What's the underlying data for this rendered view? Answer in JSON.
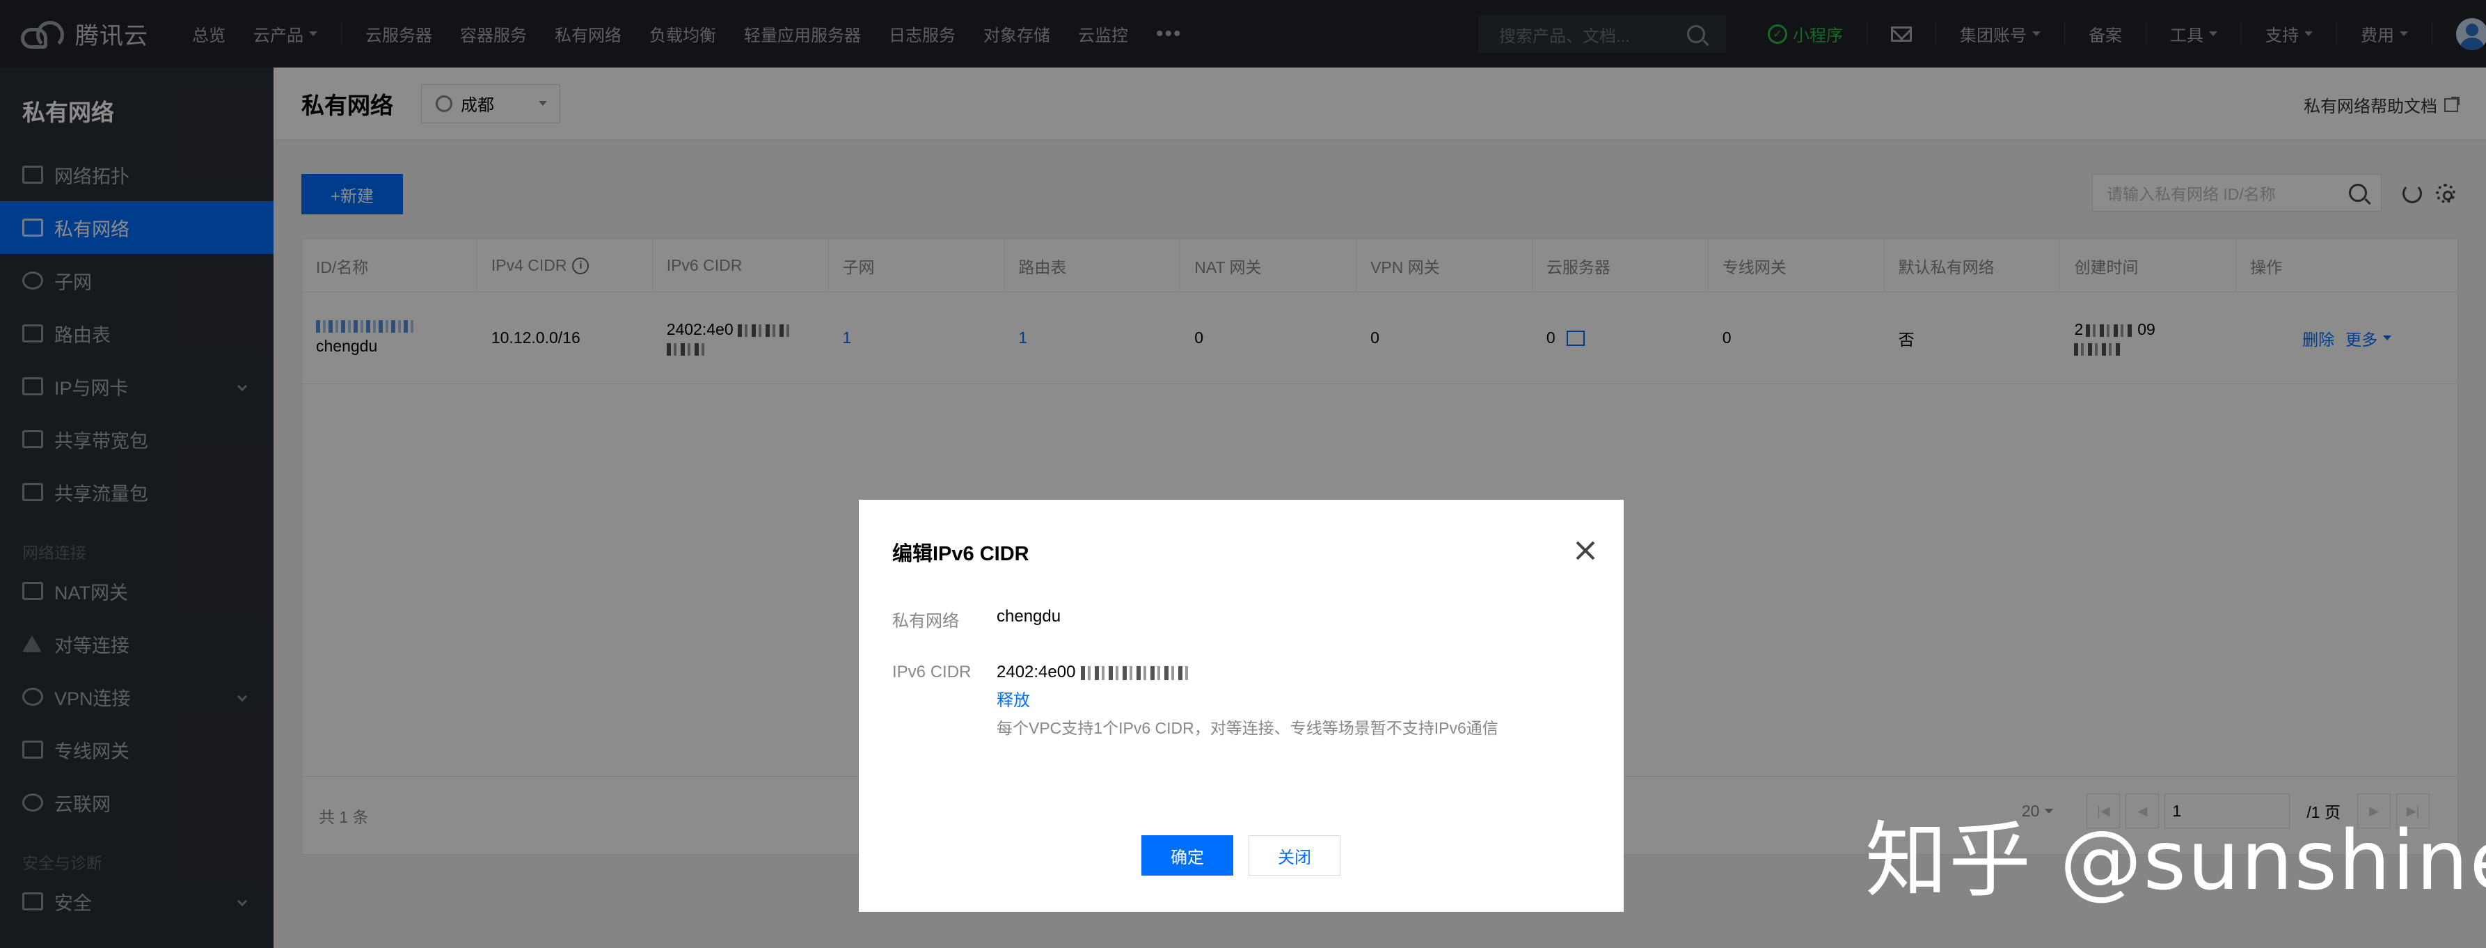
{
  "topnav": {
    "brand": "腾讯云",
    "items": [
      "总览",
      "云产品",
      "云服务器",
      "容器服务",
      "私有网络",
      "负载均衡",
      "轻量应用服务器",
      "日志服务",
      "对象存储",
      "云监控"
    ],
    "search_placeholder": "搜索产品、文档...",
    "mini_program": "小程序",
    "right_items": [
      "集团账号",
      "备案",
      "工具",
      "支持",
      "费用"
    ]
  },
  "sidebar": {
    "title": "私有网络",
    "items": [
      "网络拓扑",
      "私有网络",
      "子网",
      "路由表",
      "IP与网卡",
      "共享带宽包",
      "共享流量包"
    ],
    "group_connect": "网络连接",
    "connect_items": [
      "NAT网关",
      "对等连接",
      "VPN连接",
      "专线网关",
      "云联网"
    ],
    "group_security": "安全与诊断",
    "security_items": [
      "安全"
    ]
  },
  "header": {
    "title": "私有网络",
    "region": "成都",
    "help": "私有网络帮助文档"
  },
  "toolbar": {
    "new_label": "+新建",
    "search_placeholder": "请输入私有网络 ID/名称"
  },
  "table": {
    "columns": [
      "ID/名称",
      "IPv4 CIDR",
      "IPv6 CIDR",
      "子网",
      "路由表",
      "NAT 网关",
      "VPN 网关",
      "云服务器",
      "专线网关",
      "默认私有网络",
      "创建时间",
      "操作"
    ],
    "row": {
      "name": "chengdu",
      "ipv4": "10.12.0.0/16",
      "ipv6": "2402:4e0",
      "subnet": "1",
      "route": "1",
      "nat": "0",
      "vpn": "0",
      "cvm": "0",
      "dc": "0",
      "default": "否",
      "created_prefix": "2",
      "created_suffix": "09",
      "op_delete": "删除",
      "op_more": "更多"
    },
    "total": "共 1 条",
    "page_size": "20",
    "page": "1",
    "page_total": "/1 页"
  },
  "modal": {
    "title": "编辑IPv6 CIDR",
    "label_vpc": "私有网络",
    "vpc_value": "chengdu",
    "label_ipv6": "IPv6 CIDR",
    "ipv6_value": "2402:4e00",
    "release": "释放",
    "hint": "每个VPC支持1个IPv6 CIDR，对等连接、专线等场景暂不支持IPv6通信",
    "ok": "确定",
    "cancel": "关闭"
  },
  "watermark": "知乎 @sunshine"
}
